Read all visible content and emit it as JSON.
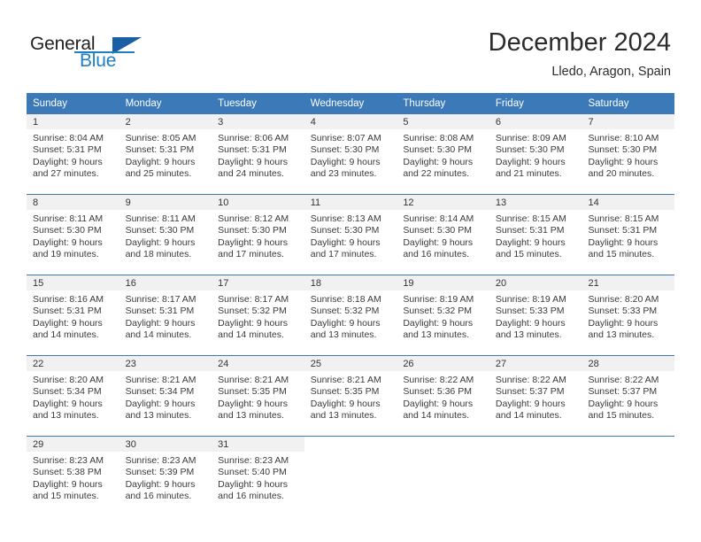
{
  "logo": {
    "word_one": "General",
    "word_two": "Blue",
    "accent_color": "#1f7fc4",
    "triangle_color": "#1a5fa3"
  },
  "header": {
    "title": "December 2024",
    "location": "Lledo, Aragon, Spain"
  },
  "theme": {
    "header_row_color": "#3b79b8",
    "day_band_color": "#f1f1f1",
    "text_color": "#3a3a3a"
  },
  "weekdays": [
    "Sunday",
    "Monday",
    "Tuesday",
    "Wednesday",
    "Thursday",
    "Friday",
    "Saturday"
  ],
  "weeks": [
    [
      {
        "day": "1",
        "sunrise": "Sunrise: 8:04 AM",
        "sunset": "Sunset: 5:31 PM",
        "daylight_line1": "Daylight: 9 hours",
        "daylight_line2": "and 27 minutes."
      },
      {
        "day": "2",
        "sunrise": "Sunrise: 8:05 AM",
        "sunset": "Sunset: 5:31 PM",
        "daylight_line1": "Daylight: 9 hours",
        "daylight_line2": "and 25 minutes."
      },
      {
        "day": "3",
        "sunrise": "Sunrise: 8:06 AM",
        "sunset": "Sunset: 5:31 PM",
        "daylight_line1": "Daylight: 9 hours",
        "daylight_line2": "and 24 minutes."
      },
      {
        "day": "4",
        "sunrise": "Sunrise: 8:07 AM",
        "sunset": "Sunset: 5:30 PM",
        "daylight_line1": "Daylight: 9 hours",
        "daylight_line2": "and 23 minutes."
      },
      {
        "day": "5",
        "sunrise": "Sunrise: 8:08 AM",
        "sunset": "Sunset: 5:30 PM",
        "daylight_line1": "Daylight: 9 hours",
        "daylight_line2": "and 22 minutes."
      },
      {
        "day": "6",
        "sunrise": "Sunrise: 8:09 AM",
        "sunset": "Sunset: 5:30 PM",
        "daylight_line1": "Daylight: 9 hours",
        "daylight_line2": "and 21 minutes."
      },
      {
        "day": "7",
        "sunrise": "Sunrise: 8:10 AM",
        "sunset": "Sunset: 5:30 PM",
        "daylight_line1": "Daylight: 9 hours",
        "daylight_line2": "and 20 minutes."
      }
    ],
    [
      {
        "day": "8",
        "sunrise": "Sunrise: 8:11 AM",
        "sunset": "Sunset: 5:30 PM",
        "daylight_line1": "Daylight: 9 hours",
        "daylight_line2": "and 19 minutes."
      },
      {
        "day": "9",
        "sunrise": "Sunrise: 8:11 AM",
        "sunset": "Sunset: 5:30 PM",
        "daylight_line1": "Daylight: 9 hours",
        "daylight_line2": "and 18 minutes."
      },
      {
        "day": "10",
        "sunrise": "Sunrise: 8:12 AM",
        "sunset": "Sunset: 5:30 PM",
        "daylight_line1": "Daylight: 9 hours",
        "daylight_line2": "and 17 minutes."
      },
      {
        "day": "11",
        "sunrise": "Sunrise: 8:13 AM",
        "sunset": "Sunset: 5:30 PM",
        "daylight_line1": "Daylight: 9 hours",
        "daylight_line2": "and 17 minutes."
      },
      {
        "day": "12",
        "sunrise": "Sunrise: 8:14 AM",
        "sunset": "Sunset: 5:30 PM",
        "daylight_line1": "Daylight: 9 hours",
        "daylight_line2": "and 16 minutes."
      },
      {
        "day": "13",
        "sunrise": "Sunrise: 8:15 AM",
        "sunset": "Sunset: 5:31 PM",
        "daylight_line1": "Daylight: 9 hours",
        "daylight_line2": "and 15 minutes."
      },
      {
        "day": "14",
        "sunrise": "Sunrise: 8:15 AM",
        "sunset": "Sunset: 5:31 PM",
        "daylight_line1": "Daylight: 9 hours",
        "daylight_line2": "and 15 minutes."
      }
    ],
    [
      {
        "day": "15",
        "sunrise": "Sunrise: 8:16 AM",
        "sunset": "Sunset: 5:31 PM",
        "daylight_line1": "Daylight: 9 hours",
        "daylight_line2": "and 14 minutes."
      },
      {
        "day": "16",
        "sunrise": "Sunrise: 8:17 AM",
        "sunset": "Sunset: 5:31 PM",
        "daylight_line1": "Daylight: 9 hours",
        "daylight_line2": "and 14 minutes."
      },
      {
        "day": "17",
        "sunrise": "Sunrise: 8:17 AM",
        "sunset": "Sunset: 5:32 PM",
        "daylight_line1": "Daylight: 9 hours",
        "daylight_line2": "and 14 minutes."
      },
      {
        "day": "18",
        "sunrise": "Sunrise: 8:18 AM",
        "sunset": "Sunset: 5:32 PM",
        "daylight_line1": "Daylight: 9 hours",
        "daylight_line2": "and 13 minutes."
      },
      {
        "day": "19",
        "sunrise": "Sunrise: 8:19 AM",
        "sunset": "Sunset: 5:32 PM",
        "daylight_line1": "Daylight: 9 hours",
        "daylight_line2": "and 13 minutes."
      },
      {
        "day": "20",
        "sunrise": "Sunrise: 8:19 AM",
        "sunset": "Sunset: 5:33 PM",
        "daylight_line1": "Daylight: 9 hours",
        "daylight_line2": "and 13 minutes."
      },
      {
        "day": "21",
        "sunrise": "Sunrise: 8:20 AM",
        "sunset": "Sunset: 5:33 PM",
        "daylight_line1": "Daylight: 9 hours",
        "daylight_line2": "and 13 minutes."
      }
    ],
    [
      {
        "day": "22",
        "sunrise": "Sunrise: 8:20 AM",
        "sunset": "Sunset: 5:34 PM",
        "daylight_line1": "Daylight: 9 hours",
        "daylight_line2": "and 13 minutes."
      },
      {
        "day": "23",
        "sunrise": "Sunrise: 8:21 AM",
        "sunset": "Sunset: 5:34 PM",
        "daylight_line1": "Daylight: 9 hours",
        "daylight_line2": "and 13 minutes."
      },
      {
        "day": "24",
        "sunrise": "Sunrise: 8:21 AM",
        "sunset": "Sunset: 5:35 PM",
        "daylight_line1": "Daylight: 9 hours",
        "daylight_line2": "and 13 minutes."
      },
      {
        "day": "25",
        "sunrise": "Sunrise: 8:21 AM",
        "sunset": "Sunset: 5:35 PM",
        "daylight_line1": "Daylight: 9 hours",
        "daylight_line2": "and 13 minutes."
      },
      {
        "day": "26",
        "sunrise": "Sunrise: 8:22 AM",
        "sunset": "Sunset: 5:36 PM",
        "daylight_line1": "Daylight: 9 hours",
        "daylight_line2": "and 14 minutes."
      },
      {
        "day": "27",
        "sunrise": "Sunrise: 8:22 AM",
        "sunset": "Sunset: 5:37 PM",
        "daylight_line1": "Daylight: 9 hours",
        "daylight_line2": "and 14 minutes."
      },
      {
        "day": "28",
        "sunrise": "Sunrise: 8:22 AM",
        "sunset": "Sunset: 5:37 PM",
        "daylight_line1": "Daylight: 9 hours",
        "daylight_line2": "and 15 minutes."
      }
    ],
    [
      {
        "day": "29",
        "sunrise": "Sunrise: 8:23 AM",
        "sunset": "Sunset: 5:38 PM",
        "daylight_line1": "Daylight: 9 hours",
        "daylight_line2": "and 15 minutes."
      },
      {
        "day": "30",
        "sunrise": "Sunrise: 8:23 AM",
        "sunset": "Sunset: 5:39 PM",
        "daylight_line1": "Daylight: 9 hours",
        "daylight_line2": "and 16 minutes."
      },
      {
        "day": "31",
        "sunrise": "Sunrise: 8:23 AM",
        "sunset": "Sunset: 5:40 PM",
        "daylight_line1": "Daylight: 9 hours",
        "daylight_line2": "and 16 minutes."
      },
      {
        "day": "",
        "sunrise": "",
        "sunset": "",
        "daylight_line1": "",
        "daylight_line2": ""
      },
      {
        "day": "",
        "sunrise": "",
        "sunset": "",
        "daylight_line1": "",
        "daylight_line2": ""
      },
      {
        "day": "",
        "sunrise": "",
        "sunset": "",
        "daylight_line1": "",
        "daylight_line2": ""
      },
      {
        "day": "",
        "sunrise": "",
        "sunset": "",
        "daylight_line1": "",
        "daylight_line2": ""
      }
    ]
  ]
}
